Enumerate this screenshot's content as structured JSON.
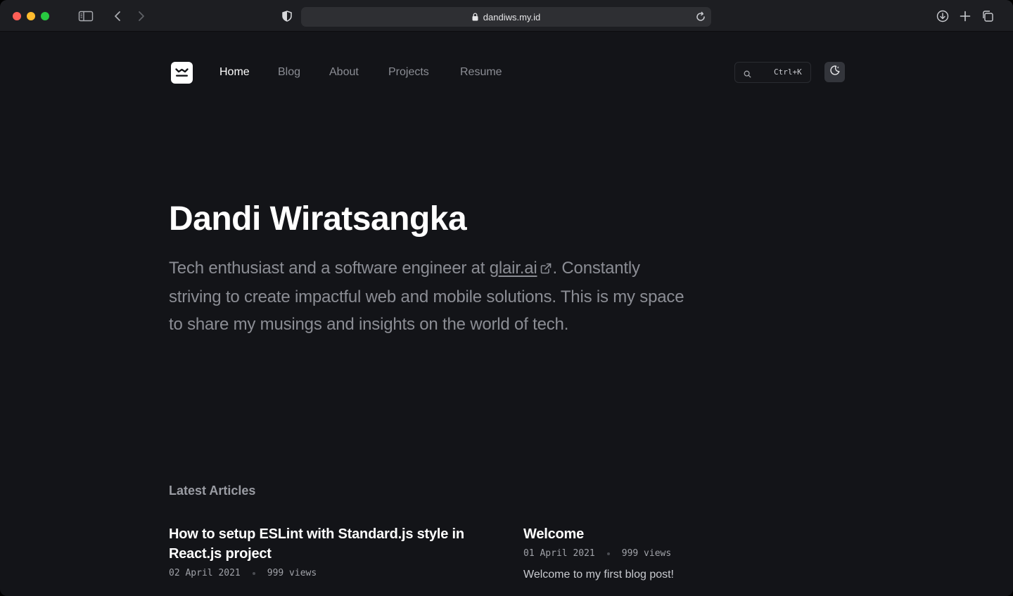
{
  "browser": {
    "url": "dandiws.my.id"
  },
  "nav": {
    "links": [
      {
        "label": "Home",
        "active": true
      },
      {
        "label": "Blog",
        "active": false
      },
      {
        "label": "About",
        "active": false
      },
      {
        "label": "Projects",
        "active": false
      },
      {
        "label": "Resume",
        "active": false
      }
    ],
    "search_shortcut": "Ctrl+K"
  },
  "hero": {
    "name": "Dandi Wiratsangka",
    "desc_before": "Tech enthusiast and a software engineer at ",
    "desc_link": "glair.ai",
    "desc_after": ". Constantly striving to create impactful web and mobile solutions. This is my space to share my musings and insights on the world of tech."
  },
  "articles_section": {
    "title": "Latest Articles",
    "items": [
      {
        "title": "How to setup ESLint with Standard.js style in React.js project",
        "date": "02 April 2021",
        "views": "999 views"
      },
      {
        "title": "Welcome",
        "date": "01 April 2021",
        "views": "999 views",
        "excerpt": "Welcome to my first blog post!"
      }
    ]
  },
  "colors": {
    "background": "#131418",
    "chrome": "#1d1e22",
    "text_primary": "#ffffff",
    "text_muted": "#8b8d94"
  }
}
